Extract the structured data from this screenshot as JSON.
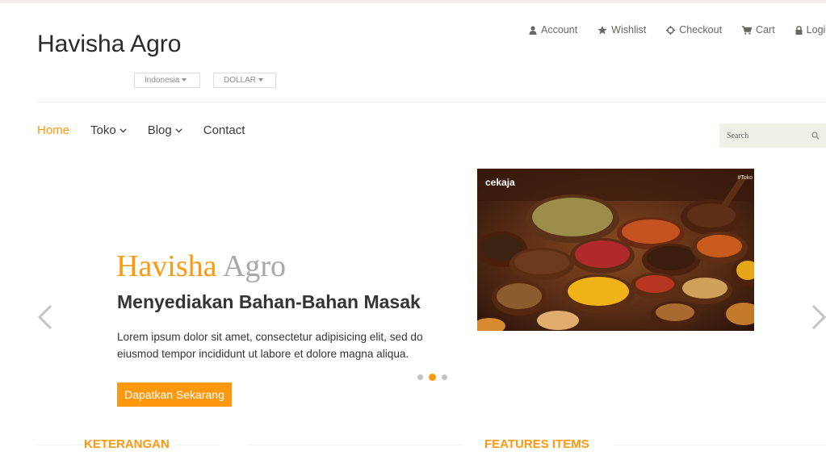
{
  "header": {
    "logo": "Havisha Agro",
    "country_selector": "Indonesia",
    "currency_selector": "DOLLAR",
    "shop_menu": [
      {
        "label": "Account",
        "icon": "user-icon"
      },
      {
        "label": "Wishlist",
        "icon": "star-icon"
      },
      {
        "label": "Checkout",
        "icon": "crosshairs-icon"
      },
      {
        "label": "Cart",
        "icon": "shopping-cart-icon"
      },
      {
        "label": "Login",
        "icon": "lock-icon"
      }
    ]
  },
  "nav": {
    "items": [
      {
        "label": "Home",
        "active": true
      },
      {
        "label": "Toko",
        "dropdown": true
      },
      {
        "label": "Blog",
        "dropdown": true
      },
      {
        "label": "Contact"
      }
    ],
    "search_placeholder": "Search"
  },
  "slider": {
    "brand_part1": "Havisha",
    "brand_part2": "Agro",
    "heading": "Menyediakan Bahan-Bahan Masak",
    "text": "Lorem ipsum dolor sit amet, consectetur adipisicing elit, sed do eiusmod tempor incididunt ut labore et dolore magna aliqua.",
    "button": "Dapatkan Sekarang",
    "image_watermark": "cekaja",
    "image_tag": "#Toko",
    "indicators": 3,
    "active_indicator": 2
  },
  "sections": {
    "left_title": "KETERANGAN",
    "right_title": "FEATURES ITEMS"
  },
  "colors": {
    "accent": "#fe980f",
    "text_dark": "#363432",
    "muted": "#a8a8a8",
    "search_bg": "#f0f0e9"
  }
}
